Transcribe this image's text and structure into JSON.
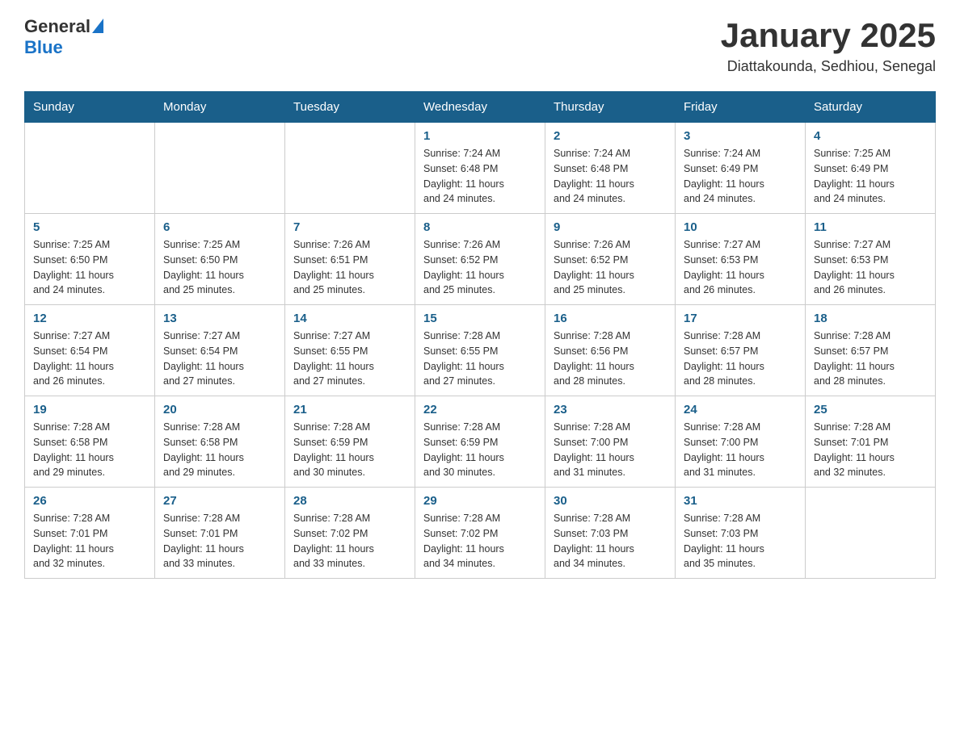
{
  "logo": {
    "text_general": "General",
    "text_blue": "Blue"
  },
  "header": {
    "month": "January 2025",
    "location": "Diattakounda, Sedhiou, Senegal"
  },
  "days_of_week": [
    "Sunday",
    "Monday",
    "Tuesday",
    "Wednesday",
    "Thursday",
    "Friday",
    "Saturday"
  ],
  "weeks": [
    [
      {
        "day": "",
        "info": ""
      },
      {
        "day": "",
        "info": ""
      },
      {
        "day": "",
        "info": ""
      },
      {
        "day": "1",
        "info": "Sunrise: 7:24 AM\nSunset: 6:48 PM\nDaylight: 11 hours\nand 24 minutes."
      },
      {
        "day": "2",
        "info": "Sunrise: 7:24 AM\nSunset: 6:48 PM\nDaylight: 11 hours\nand 24 minutes."
      },
      {
        "day": "3",
        "info": "Sunrise: 7:24 AM\nSunset: 6:49 PM\nDaylight: 11 hours\nand 24 minutes."
      },
      {
        "day": "4",
        "info": "Sunrise: 7:25 AM\nSunset: 6:49 PM\nDaylight: 11 hours\nand 24 minutes."
      }
    ],
    [
      {
        "day": "5",
        "info": "Sunrise: 7:25 AM\nSunset: 6:50 PM\nDaylight: 11 hours\nand 24 minutes."
      },
      {
        "day": "6",
        "info": "Sunrise: 7:25 AM\nSunset: 6:50 PM\nDaylight: 11 hours\nand 25 minutes."
      },
      {
        "day": "7",
        "info": "Sunrise: 7:26 AM\nSunset: 6:51 PM\nDaylight: 11 hours\nand 25 minutes."
      },
      {
        "day": "8",
        "info": "Sunrise: 7:26 AM\nSunset: 6:52 PM\nDaylight: 11 hours\nand 25 minutes."
      },
      {
        "day": "9",
        "info": "Sunrise: 7:26 AM\nSunset: 6:52 PM\nDaylight: 11 hours\nand 25 minutes."
      },
      {
        "day": "10",
        "info": "Sunrise: 7:27 AM\nSunset: 6:53 PM\nDaylight: 11 hours\nand 26 minutes."
      },
      {
        "day": "11",
        "info": "Sunrise: 7:27 AM\nSunset: 6:53 PM\nDaylight: 11 hours\nand 26 minutes."
      }
    ],
    [
      {
        "day": "12",
        "info": "Sunrise: 7:27 AM\nSunset: 6:54 PM\nDaylight: 11 hours\nand 26 minutes."
      },
      {
        "day": "13",
        "info": "Sunrise: 7:27 AM\nSunset: 6:54 PM\nDaylight: 11 hours\nand 27 minutes."
      },
      {
        "day": "14",
        "info": "Sunrise: 7:27 AM\nSunset: 6:55 PM\nDaylight: 11 hours\nand 27 minutes."
      },
      {
        "day": "15",
        "info": "Sunrise: 7:28 AM\nSunset: 6:55 PM\nDaylight: 11 hours\nand 27 minutes."
      },
      {
        "day": "16",
        "info": "Sunrise: 7:28 AM\nSunset: 6:56 PM\nDaylight: 11 hours\nand 28 minutes."
      },
      {
        "day": "17",
        "info": "Sunrise: 7:28 AM\nSunset: 6:57 PM\nDaylight: 11 hours\nand 28 minutes."
      },
      {
        "day": "18",
        "info": "Sunrise: 7:28 AM\nSunset: 6:57 PM\nDaylight: 11 hours\nand 28 minutes."
      }
    ],
    [
      {
        "day": "19",
        "info": "Sunrise: 7:28 AM\nSunset: 6:58 PM\nDaylight: 11 hours\nand 29 minutes."
      },
      {
        "day": "20",
        "info": "Sunrise: 7:28 AM\nSunset: 6:58 PM\nDaylight: 11 hours\nand 29 minutes."
      },
      {
        "day": "21",
        "info": "Sunrise: 7:28 AM\nSunset: 6:59 PM\nDaylight: 11 hours\nand 30 minutes."
      },
      {
        "day": "22",
        "info": "Sunrise: 7:28 AM\nSunset: 6:59 PM\nDaylight: 11 hours\nand 30 minutes."
      },
      {
        "day": "23",
        "info": "Sunrise: 7:28 AM\nSunset: 7:00 PM\nDaylight: 11 hours\nand 31 minutes."
      },
      {
        "day": "24",
        "info": "Sunrise: 7:28 AM\nSunset: 7:00 PM\nDaylight: 11 hours\nand 31 minutes."
      },
      {
        "day": "25",
        "info": "Sunrise: 7:28 AM\nSunset: 7:01 PM\nDaylight: 11 hours\nand 32 minutes."
      }
    ],
    [
      {
        "day": "26",
        "info": "Sunrise: 7:28 AM\nSunset: 7:01 PM\nDaylight: 11 hours\nand 32 minutes."
      },
      {
        "day": "27",
        "info": "Sunrise: 7:28 AM\nSunset: 7:01 PM\nDaylight: 11 hours\nand 33 minutes."
      },
      {
        "day": "28",
        "info": "Sunrise: 7:28 AM\nSunset: 7:02 PM\nDaylight: 11 hours\nand 33 minutes."
      },
      {
        "day": "29",
        "info": "Sunrise: 7:28 AM\nSunset: 7:02 PM\nDaylight: 11 hours\nand 34 minutes."
      },
      {
        "day": "30",
        "info": "Sunrise: 7:28 AM\nSunset: 7:03 PM\nDaylight: 11 hours\nand 34 minutes."
      },
      {
        "day": "31",
        "info": "Sunrise: 7:28 AM\nSunset: 7:03 PM\nDaylight: 11 hours\nand 35 minutes."
      },
      {
        "day": "",
        "info": ""
      }
    ]
  ]
}
